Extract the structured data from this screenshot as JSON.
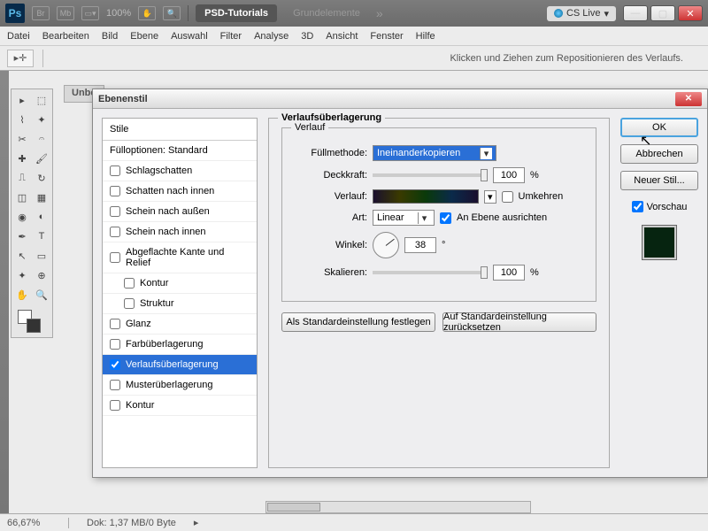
{
  "app": {
    "zoom": "100%",
    "badge1": "PSD-Tutorials",
    "badge2": "Grundelemente",
    "cslive": "CS Live"
  },
  "menus": [
    "Datei",
    "Bearbeiten",
    "Bild",
    "Ebene",
    "Auswahl",
    "Filter",
    "Analyse",
    "3D",
    "Ansicht",
    "Fenster",
    "Hilfe"
  ],
  "optbar": {
    "hint": "Klicken und Ziehen zum Repositionieren des Verlaufs."
  },
  "doc": {
    "tab": "Unbe"
  },
  "status": {
    "zoom": "66,67%",
    "info": "Dok: 1,37 MB/0 Byte"
  },
  "dialog": {
    "title": "Ebenenstil",
    "styles_header": "Stile",
    "fill_options": "Fülloptionen: Standard",
    "effects": [
      {
        "label": "Schlagschatten",
        "checked": false
      },
      {
        "label": "Schatten nach innen",
        "checked": false
      },
      {
        "label": "Schein nach außen",
        "checked": false
      },
      {
        "label": "Schein nach innen",
        "checked": false
      },
      {
        "label": "Abgeflachte Kante und Relief",
        "checked": false
      },
      {
        "label": "Kontur",
        "checked": false,
        "sub": true
      },
      {
        "label": "Struktur",
        "checked": false,
        "sub": true
      },
      {
        "label": "Glanz",
        "checked": false
      },
      {
        "label": "Farbüberlagerung",
        "checked": false
      },
      {
        "label": "Verlaufsüberlagerung",
        "checked": true,
        "selected": true
      },
      {
        "label": "Musterüberlagerung",
        "checked": false
      },
      {
        "label": "Kontur",
        "checked": false
      }
    ],
    "group_title": "Verlaufsüberlagerung",
    "inner_group": "Verlauf",
    "labels": {
      "blend": "Füllmethode:",
      "opacity": "Deckkraft:",
      "gradient": "Verlauf:",
      "reverse": "Umkehren",
      "style": "Art:",
      "align": "An Ebene ausrichten",
      "angle": "Winkel:",
      "scale": "Skalieren:"
    },
    "values": {
      "blend_mode": "Ineinanderkopieren",
      "opacity": "100",
      "opacity_unit": "%",
      "style_mode": "Linear",
      "angle": "38",
      "angle_unit": "°",
      "scale": "100",
      "scale_unit": "%"
    },
    "btns": {
      "default_set": "Als Standardeinstellung festlegen",
      "default_reset": "Auf Standardeinstellung zurücksetzen"
    },
    "right": {
      "ok": "OK",
      "cancel": "Abbrechen",
      "newstyle": "Neuer Stil...",
      "preview": "Vorschau"
    }
  }
}
